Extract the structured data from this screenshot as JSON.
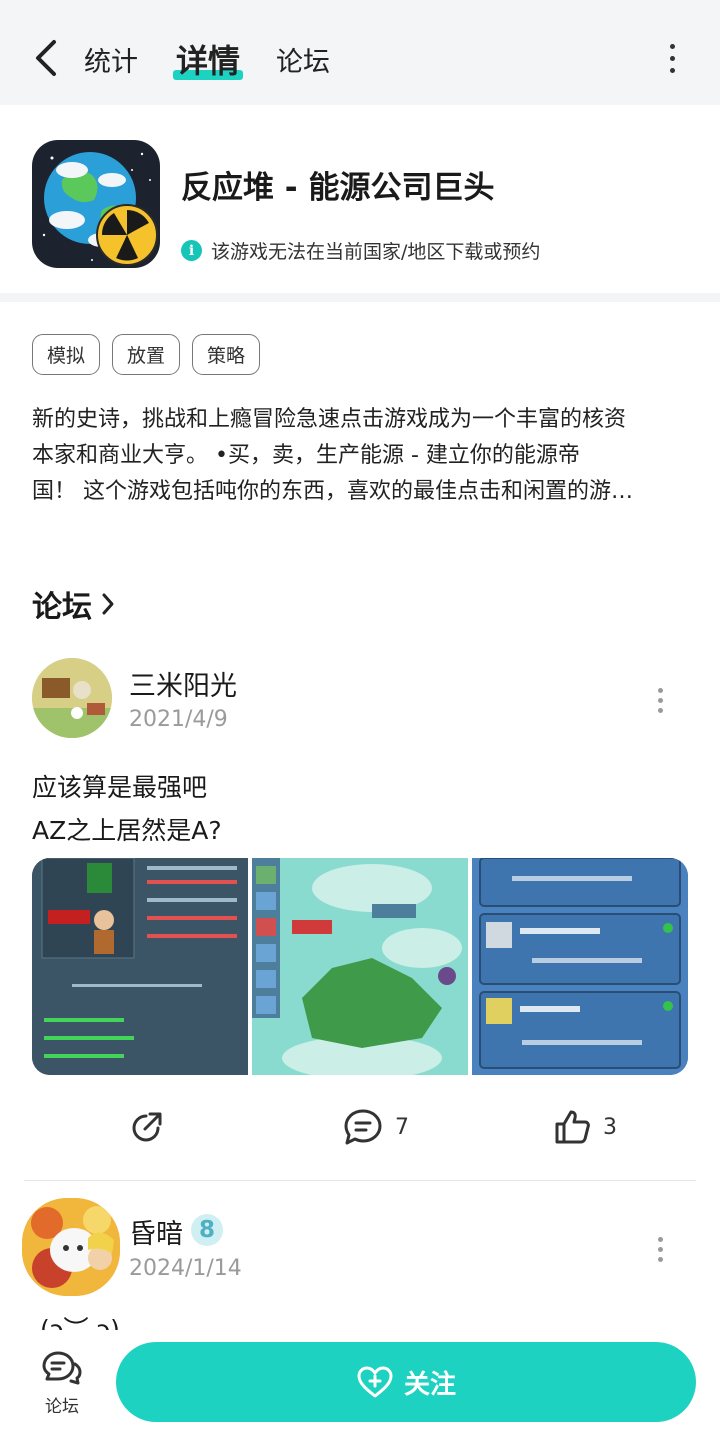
{
  "header": {
    "tabs": [
      {
        "label": "统计"
      },
      {
        "label": "详情",
        "active": true
      },
      {
        "label": "论坛"
      }
    ]
  },
  "app": {
    "title": "反应堆 - 能源公司巨头",
    "notice": "该游戏无法在当前国家/地区下载或预约"
  },
  "tags": [
    "模拟",
    "放置",
    "策略"
  ],
  "description": {
    "lines": [
      "新的史诗，挑战和上瘾冒险急速点击游戏成为一个丰富的核资",
      "本家和商业大亨。 •买，卖，生产能源 - 建立你的能源帝",
      "国！ 这个游戏包括吨你的东西，喜欢的最佳点击和闲置的游…"
    ]
  },
  "forum": {
    "title": "论坛"
  },
  "posts": [
    {
      "author": "三米阳光",
      "date": "2021/4/9",
      "text_lines": [
        "应该算是最强吧",
        "AZ之上居然是A?"
      ],
      "comments": "7",
      "likes": "3"
    },
    {
      "author": "昏暗",
      "level": "8",
      "date": "2024/1/14",
      "partial_text": "(ɔ︶ ɔ)"
    }
  ],
  "bottom": {
    "forum_label": "论坛",
    "follow_label": "关注"
  },
  "colors": {
    "accent": "#1ed2c2",
    "topbar_bg": "#f4f5f6",
    "muted_text": "#9a9a9a"
  }
}
